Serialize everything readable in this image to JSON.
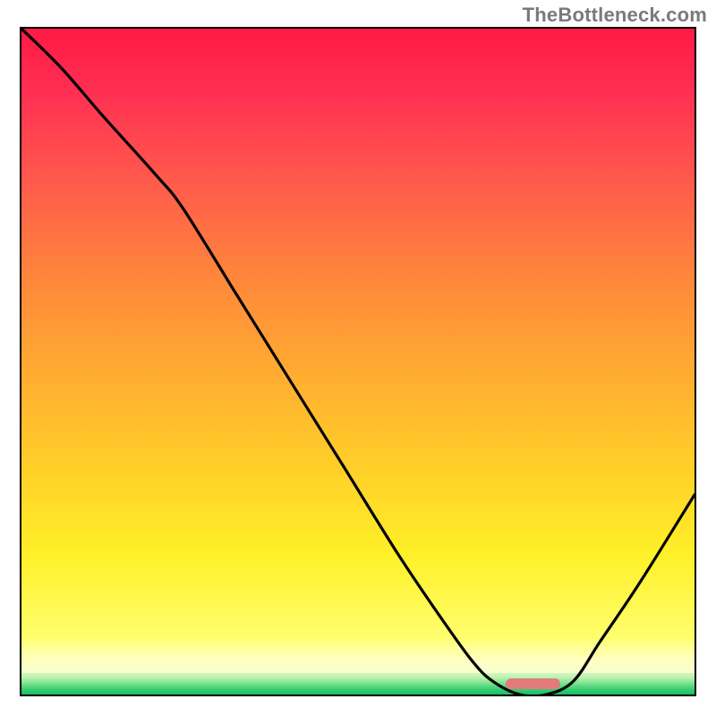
{
  "watermark": "TheBottleneck.com",
  "chart_data": {
    "type": "line",
    "title": "",
    "xlabel": "",
    "ylabel": "",
    "xlim": [
      0,
      100
    ],
    "ylim": [
      0,
      100
    ],
    "grid": false,
    "legend": false,
    "series": [
      {
        "name": "bottleneck-curve",
        "x": [
          0,
          6,
          12,
          20,
          24,
          32,
          40,
          48,
          56,
          62,
          67,
          70,
          74,
          78,
          82,
          86,
          92,
          100
        ],
        "y": [
          100,
          94,
          87,
          78,
          73,
          60,
          47,
          34,
          21,
          12,
          5,
          2,
          0,
          0,
          2,
          8,
          17,
          30
        ]
      }
    ],
    "annotations": {
      "optimal_marker": {
        "x_start": 72,
        "x_end": 80,
        "y": 0,
        "color": "#e37b7b"
      }
    },
    "background_gradient": {
      "stops": [
        {
          "pos": 0.0,
          "color": "#ff1a44"
        },
        {
          "pos": 0.45,
          "color": "#ff8a3a"
        },
        {
          "pos": 0.82,
          "color": "#ffff70"
        },
        {
          "pos": 0.94,
          "color": "#ffffc0"
        },
        {
          "pos": 1.0,
          "color": "#1abc66"
        }
      ]
    }
  }
}
